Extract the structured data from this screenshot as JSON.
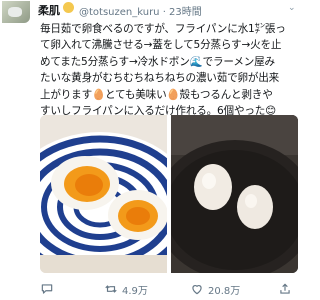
{
  "user": {
    "display_name": "柔肌",
    "handle_time": "@totsuzen_kuru · 23時間"
  },
  "tweet": {
    "text": "毎日茹で卵食べるのですが、フライパンに水1㌢張っ\nて卵入れて沸騰させる→蓋をして5分蒸らす→火を止\nめてまた5分蒸らす→冷水ドボン🌊でラーメン屋み\nたいな黄身がむちむちねちねちの濃い茹で卵が出来\n上がります🥚とても美味い🥚殻もつるんと剥きや\nすいしフライパンに入るだけ作れる。6個やった😊"
  },
  "actions": {
    "reply_count": "",
    "retweet_count": "4.9万",
    "like_count": "20.8万"
  },
  "colors": {
    "text": "#14171a",
    "muted": "#657786",
    "accent": "#1da1f2"
  }
}
